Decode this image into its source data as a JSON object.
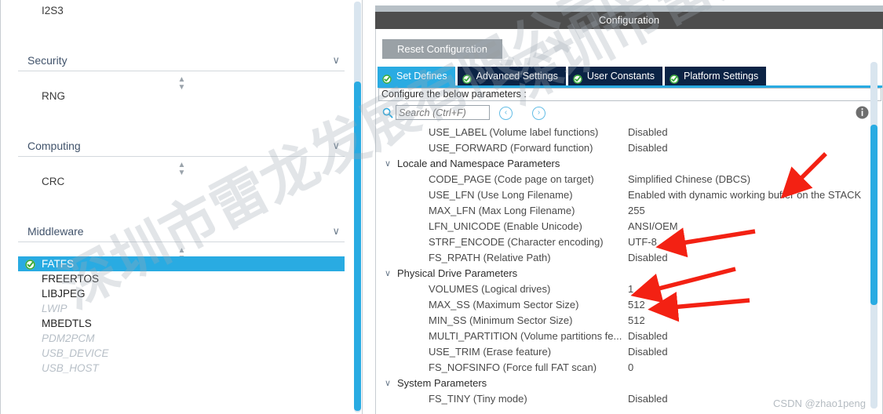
{
  "app": {
    "watermark_cn": "深圳市雷龙发展有限公司",
    "watermark_csdn": "CSDN @zhao1peng"
  },
  "sidebar": {
    "top_leaf": "I2S3",
    "groups": [
      {
        "name": "Security",
        "chevron": "chevron-down-icon",
        "items": [
          "RNG"
        ]
      },
      {
        "name": "Computing",
        "chevron": "chevron-down-icon",
        "items": [
          "CRC"
        ]
      },
      {
        "name": "Middleware",
        "chevron": "chevron-down-icon",
        "items": []
      }
    ],
    "middleware_items": [
      {
        "label": "FATFS",
        "state": "selected",
        "checked": true
      },
      {
        "label": "FREERTOS",
        "state": "normal",
        "checked": false
      },
      {
        "label": "LIBJPEG",
        "state": "normal",
        "checked": false
      },
      {
        "label": "LWIP",
        "state": "disabled",
        "checked": false
      },
      {
        "label": "MBEDTLS",
        "state": "normal",
        "checked": false
      },
      {
        "label": "PDM2PCM",
        "state": "disabled",
        "checked": false
      },
      {
        "label": "USB_DEVICE",
        "state": "disabled",
        "checked": false
      },
      {
        "label": "USB_HOST",
        "state": "disabled",
        "checked": false
      }
    ]
  },
  "config": {
    "title": "Configuration",
    "reset_label": "Reset Configuration",
    "tabs": [
      {
        "label": "Set Defines",
        "active": true
      },
      {
        "label": "Advanced Settings",
        "active": false
      },
      {
        "label": "User Constants",
        "active": false
      },
      {
        "label": "Platform Settings",
        "active": false
      }
    ],
    "configure_label": "Configure the below parameters :",
    "search": {
      "placeholder": "Search (Ctrl+F)",
      "value": "",
      "prev_glyph": "‹",
      "next_glyph": "›"
    },
    "rows": [
      {
        "kind": "param",
        "name": "USE_LABEL (Volume label functions)",
        "value": "Disabled"
      },
      {
        "kind": "param",
        "name": "USE_FORWARD (Forward function)",
        "value": "Disabled"
      },
      {
        "kind": "group",
        "name": "Locale and Namespace Parameters"
      },
      {
        "kind": "param",
        "name": "CODE_PAGE (Code page on target)",
        "value": "Simplified Chinese (DBCS)"
      },
      {
        "kind": "param",
        "name": "USE_LFN (Use Long Filename)",
        "value": "Enabled with dynamic working buffer on the STACK"
      },
      {
        "kind": "param",
        "name": "MAX_LFN (Max Long Filename)",
        "value": "255"
      },
      {
        "kind": "param",
        "name": "LFN_UNICODE (Enable Unicode)",
        "value": "ANSI/OEM"
      },
      {
        "kind": "param",
        "name": "STRF_ENCODE (Character encoding)",
        "value": "UTF-8"
      },
      {
        "kind": "param",
        "name": "FS_RPATH (Relative Path)",
        "value": "Disabled"
      },
      {
        "kind": "group",
        "name": "Physical Drive Parameters"
      },
      {
        "kind": "param",
        "name": "VOLUMES (Logical drives)",
        "value": "1"
      },
      {
        "kind": "param",
        "name": "MAX_SS (Maximum Sector Size)",
        "value": "512"
      },
      {
        "kind": "param",
        "name": "MIN_SS (Minimum Sector Size)",
        "value": "512"
      },
      {
        "kind": "param",
        "name": "MULTI_PARTITION (Volume partitions fe...",
        "value": "Disabled"
      },
      {
        "kind": "param",
        "name": "USE_TRIM (Erase feature)",
        "value": "Disabled"
      },
      {
        "kind": "param",
        "name": "FS_NOFSINFO (Force full FAT scan)",
        "value": "0"
      },
      {
        "kind": "group",
        "name": "System Parameters"
      },
      {
        "kind": "param",
        "name": "FS_TINY (Tiny mode)",
        "value": "Disabled"
      }
    ]
  },
  "colors": {
    "accent": "#29abe2",
    "tab_inactive": "#0b2345",
    "title_bar": "#4d4d4d",
    "button_gray": "#9aa1a6",
    "annotation_red": "#f32113",
    "check_green": "#3aab3a"
  }
}
